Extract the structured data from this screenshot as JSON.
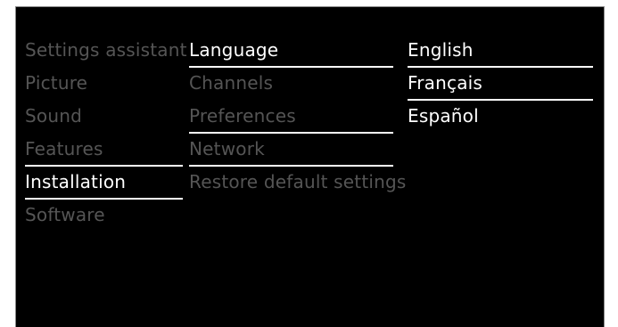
{
  "menu": {
    "main_items": [
      {
        "label": "Settings assistant"
      },
      {
        "label": "Picture"
      },
      {
        "label": "Sound"
      },
      {
        "label": "Features"
      },
      {
        "label": "Installation"
      },
      {
        "label": "Software"
      }
    ],
    "installation_items": [
      {
        "label": "Language"
      },
      {
        "label": "Channels"
      },
      {
        "label": "Preferences"
      },
      {
        "label": "Network"
      },
      {
        "label": "Restore default settings"
      }
    ],
    "language_options": [
      {
        "label": "English"
      },
      {
        "label": "Français"
      },
      {
        "label": "Español"
      }
    ]
  },
  "colors": {
    "background": "#000000",
    "active_text": "#ffffff",
    "inactive_text": "#555555",
    "separator": "#ffffff"
  }
}
